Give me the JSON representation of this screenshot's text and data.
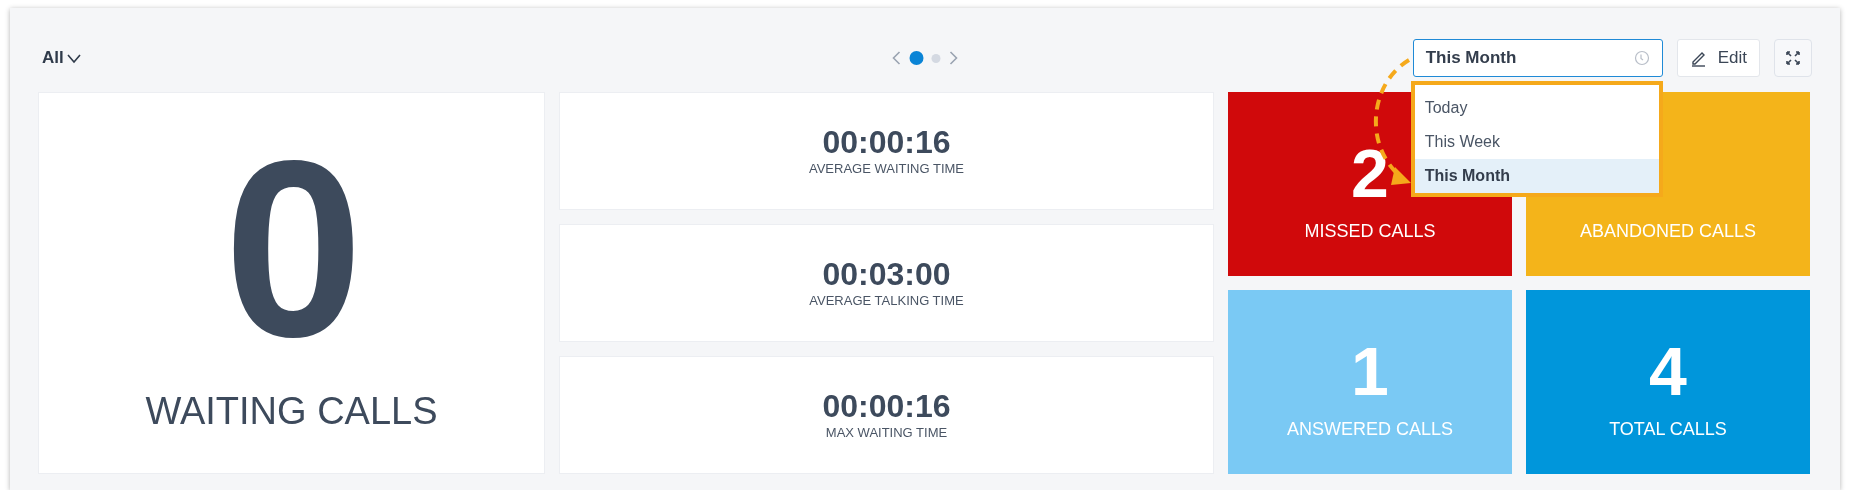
{
  "filter": {
    "label": "All"
  },
  "pager": {
    "pages": [
      {
        "selected": true
      },
      {
        "selected": false
      }
    ]
  },
  "period": {
    "value": "This Month",
    "options": [
      {
        "label": "Today",
        "selected": false
      },
      {
        "label": "This Week",
        "selected": false
      },
      {
        "label": "This Month",
        "selected": true
      }
    ]
  },
  "edit_button": {
    "label": "Edit"
  },
  "waiting": {
    "value": "0",
    "label": "WAITING CALLS"
  },
  "metrics": [
    {
      "value": "00:00:16",
      "label": "AVERAGE WAITING TIME"
    },
    {
      "value": "00:03:00",
      "label": "AVERAGE TALKING TIME"
    },
    {
      "value": "00:00:16",
      "label": "MAX WAITING TIME"
    }
  ],
  "tiles": [
    {
      "value": "2",
      "label": "MISSED CALLS",
      "color": "#d0090b"
    },
    {
      "label": "ABANDONED CALLS",
      "color": "#f4b41a"
    },
    {
      "value": "1",
      "label": "ANSWERED CALLS",
      "color": "#7ac9f4"
    },
    {
      "value": "4",
      "label": "TOTAL CALLS",
      "color": "#0096db"
    }
  ]
}
